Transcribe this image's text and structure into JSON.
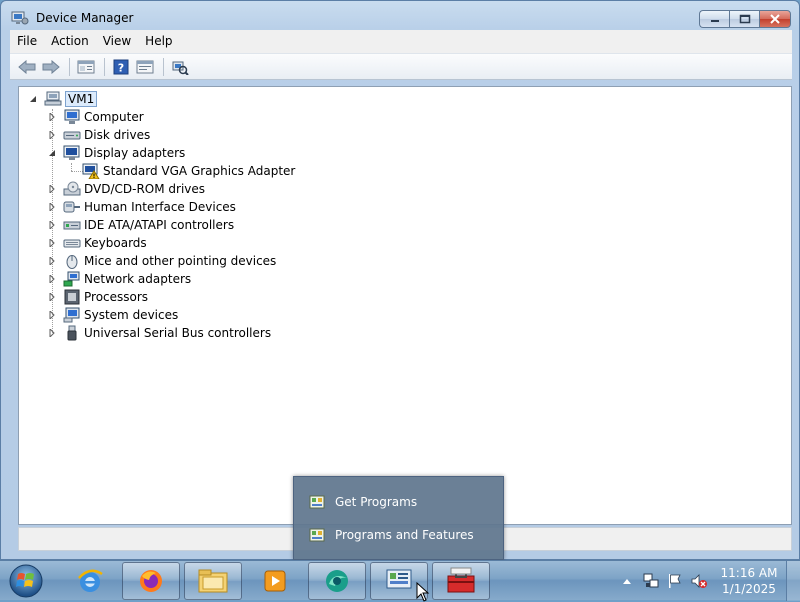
{
  "window": {
    "title": "Device Manager",
    "controls": [
      "minimize",
      "maximize",
      "close"
    ]
  },
  "menu": [
    "File",
    "Action",
    "View",
    "Help"
  ],
  "toolbar": {
    "buttons": [
      "back-arrow-icon",
      "forward-arrow-icon",
      "properties-icon",
      "help-icon",
      "console-tree-icon",
      "scan-hardware-icon"
    ]
  },
  "tree": {
    "root": "VM1",
    "nodes": [
      {
        "label": "Computer",
        "icon": "computer-icon",
        "expanded": false
      },
      {
        "label": "Disk drives",
        "icon": "disk-drive-icon",
        "expanded": false
      },
      {
        "label": "Display adapters",
        "icon": "display-adapter-icon",
        "expanded": true,
        "children": [
          {
            "label": "Standard VGA Graphics Adapter",
            "icon": "display-adapter-warning-icon"
          }
        ]
      },
      {
        "label": "DVD/CD-ROM drives",
        "icon": "dvd-drive-icon",
        "expanded": false
      },
      {
        "label": "Human Interface Devices",
        "icon": "hid-icon",
        "expanded": false
      },
      {
        "label": "IDE ATA/ATAPI controllers",
        "icon": "ide-controller-icon",
        "expanded": false
      },
      {
        "label": "Keyboards",
        "icon": "keyboard-icon",
        "expanded": false
      },
      {
        "label": "Mice and other pointing devices",
        "icon": "mouse-icon",
        "expanded": false
      },
      {
        "label": "Network adapters",
        "icon": "network-adapter-icon",
        "expanded": false
      },
      {
        "label": "Processors",
        "icon": "processor-icon",
        "expanded": false
      },
      {
        "label": "System devices",
        "icon": "system-devices-icon",
        "expanded": false
      },
      {
        "label": "Universal Serial Bus controllers",
        "icon": "usb-icon",
        "expanded": false
      }
    ]
  },
  "jumplist": {
    "items": [
      "Get Programs",
      "Programs and Features"
    ]
  },
  "taskbar": {
    "pinned": [
      "start-orb",
      "internet-explorer-icon",
      "firefox-icon",
      "file-explorer-icon",
      "media-player-icon",
      "browser-icon",
      "control-panel-icon",
      "toolbox-icon"
    ],
    "clock_time": "11:16 AM",
    "clock_date": "1/1/2025"
  },
  "colors": {
    "selection": "#dcebfc",
    "taskbar": "#7da3c6",
    "jumplist_bg": "#60768e"
  }
}
